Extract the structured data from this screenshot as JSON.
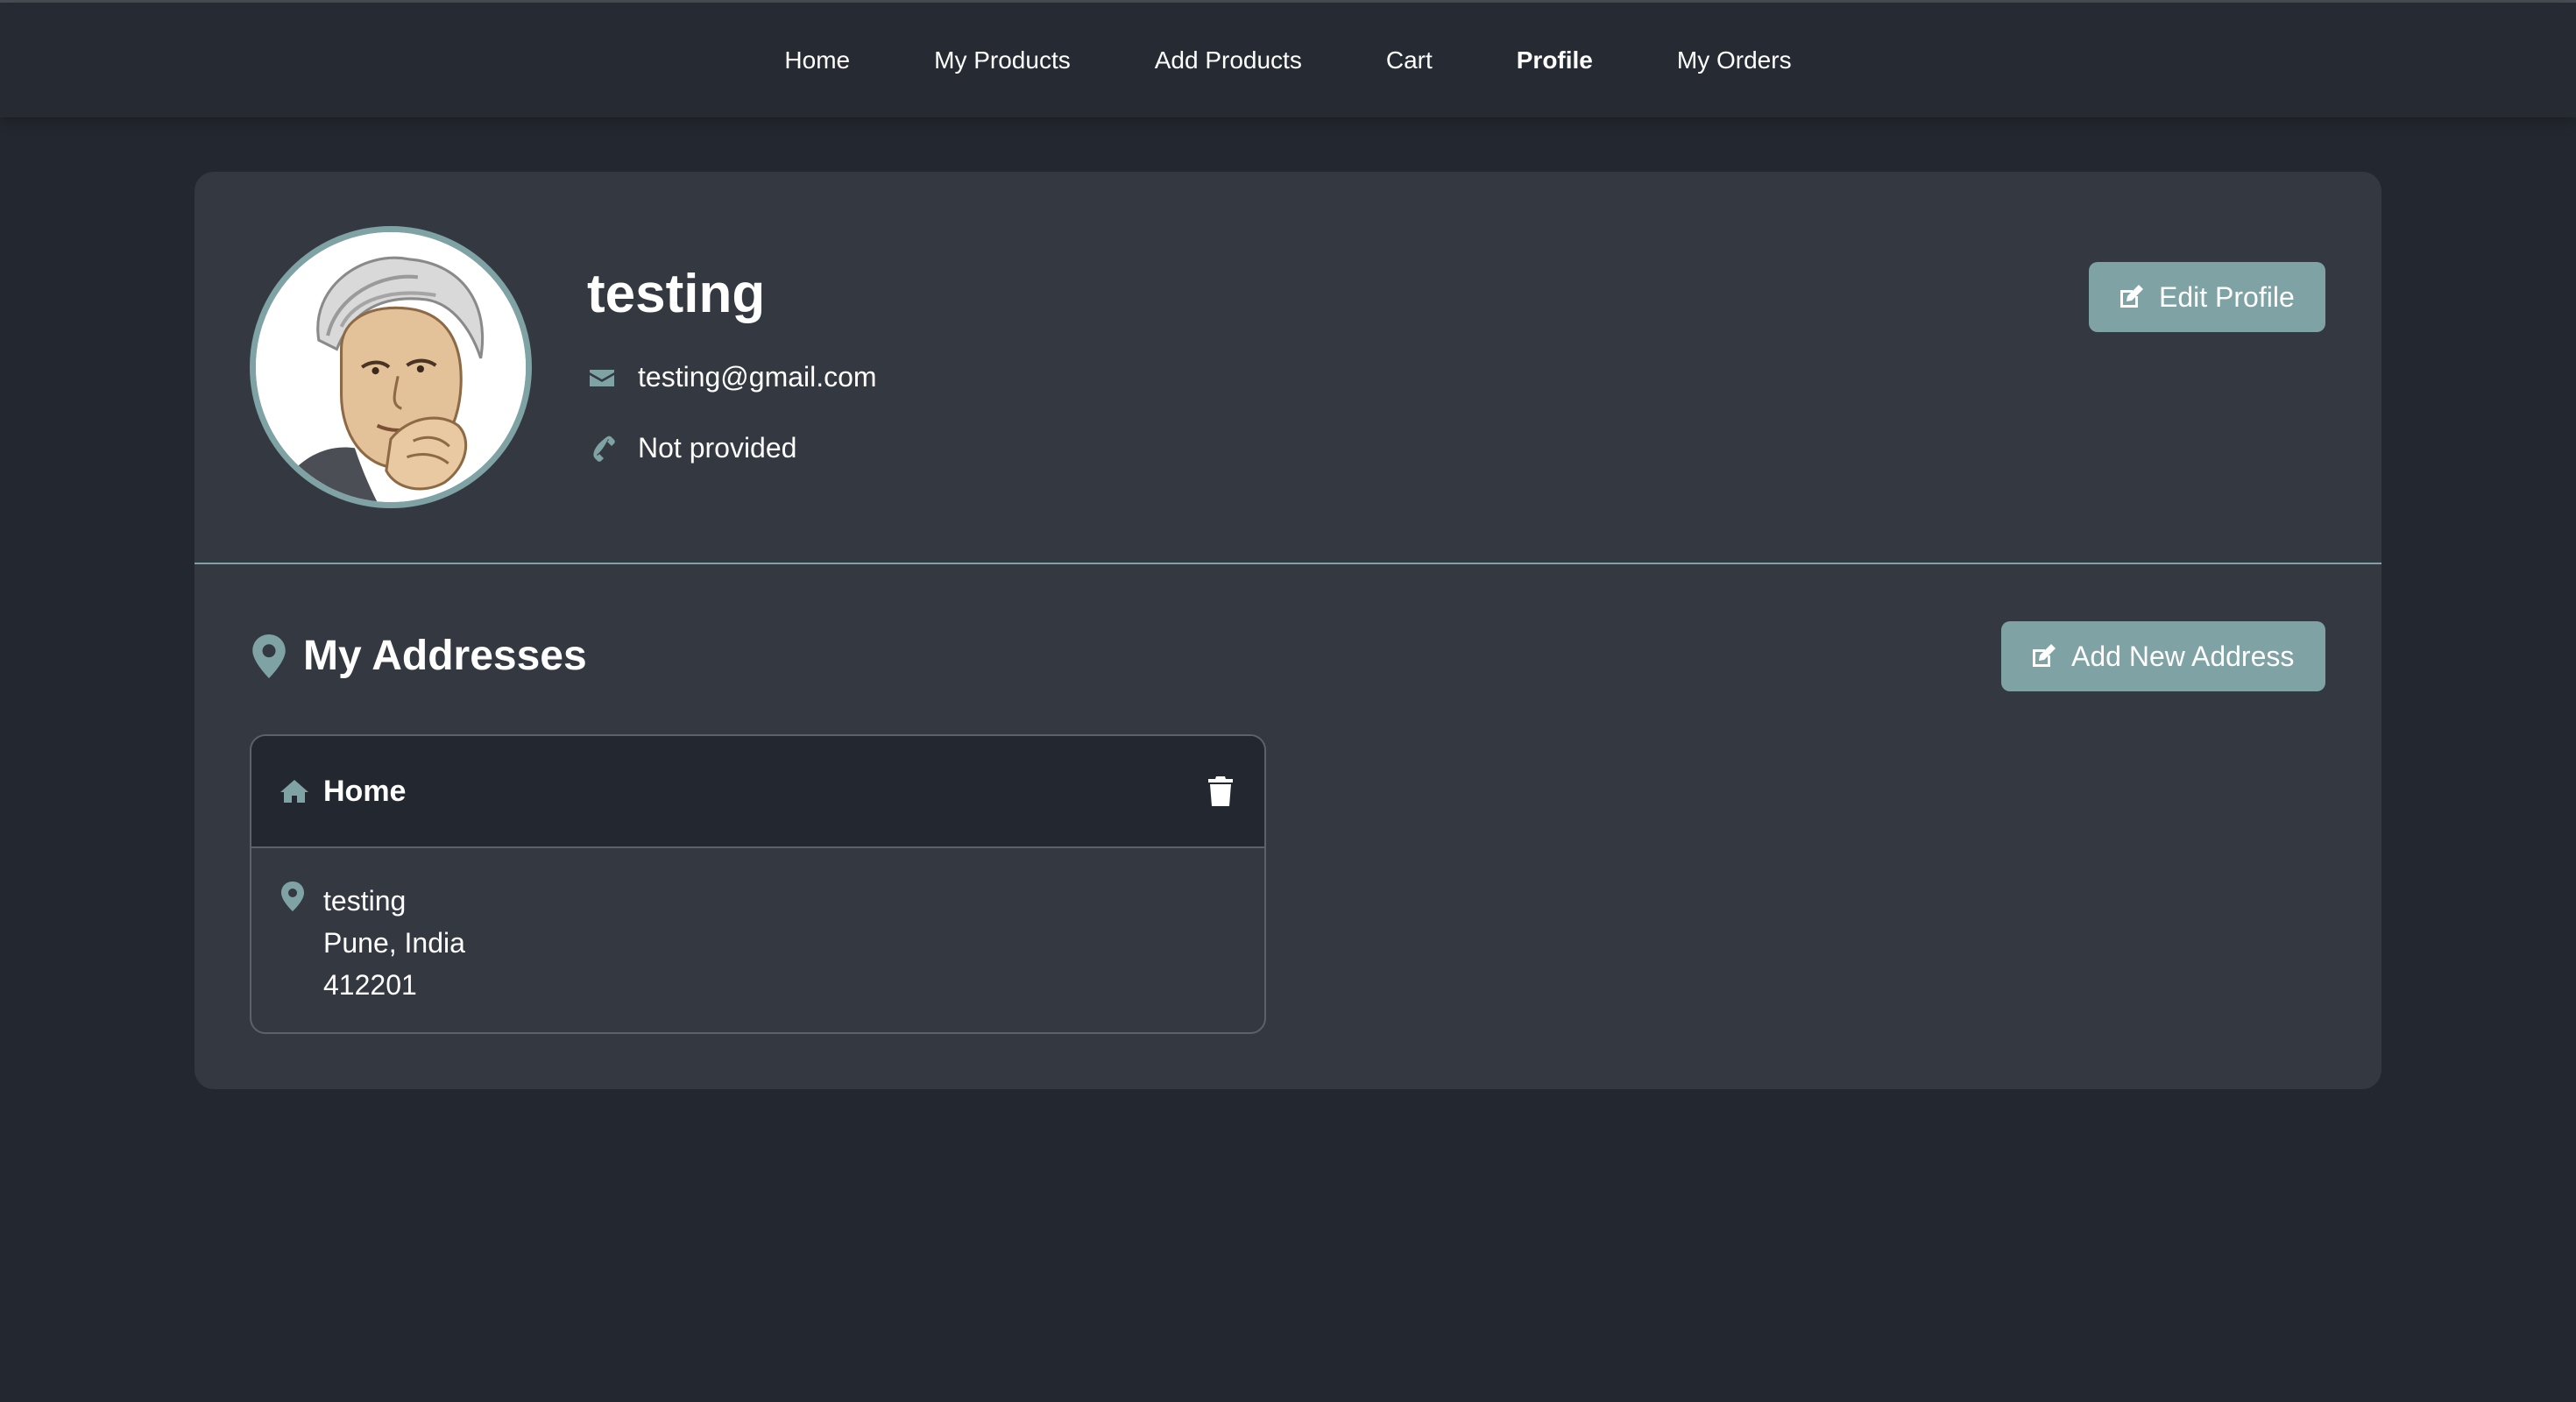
{
  "nav": {
    "items": [
      {
        "label": "Home"
      },
      {
        "label": "My Products"
      },
      {
        "label": "Add Products"
      },
      {
        "label": "Cart"
      },
      {
        "label": "Profile",
        "active": true
      },
      {
        "label": "My Orders"
      }
    ]
  },
  "profile": {
    "name": "testing",
    "email": "testing@gmail.com",
    "phone": "Not provided",
    "edit_button_label": "Edit Profile",
    "avatar_icon": "user-portrait-image"
  },
  "addresses": {
    "title": "My Addresses",
    "add_button_label": "Add New Address",
    "items": [
      {
        "type": "Home",
        "line1": "testing",
        "line2": "Pune, India",
        "line3": "412201"
      }
    ]
  },
  "colors": {
    "page_bg": "#23272f",
    "card_bg": "#343841",
    "accent": "#7fa2a4",
    "text": "#ffffff"
  }
}
